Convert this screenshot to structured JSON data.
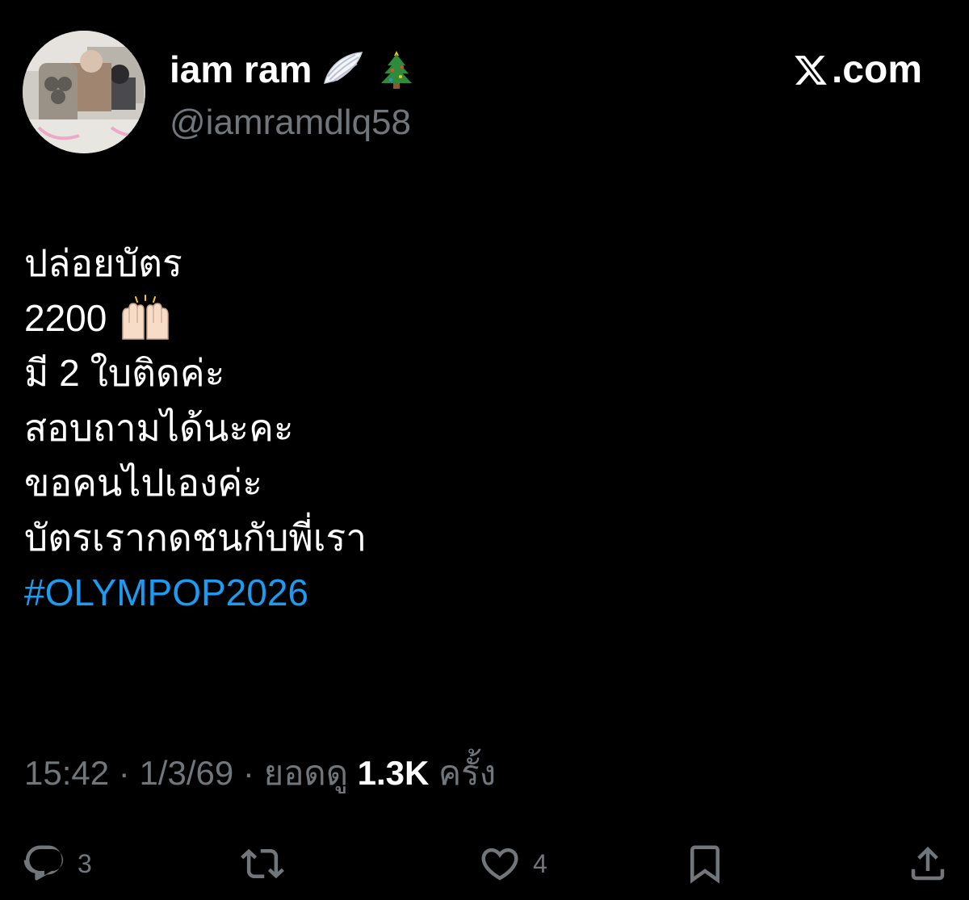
{
  "header": {
    "display_name": "iam ram",
    "name_emojis": [
      "wing-emoji",
      "christmas-tree-emoji"
    ],
    "handle": "@iamramdlq58",
    "brand": {
      "logo": "x-logo-icon",
      "domain": ".com"
    },
    "avatar": "profile-photo"
  },
  "tweet": {
    "lines": [
      "ปล่อยบัตร",
      "2200",
      "มี 2 ใบติดค่ะ",
      "สอบถามได้นะคะ",
      "ขอคนไปเองค่ะ",
      "บัตรเรากดชนกับพี่เรา"
    ],
    "line2_emoji": "raising-hands-emoji",
    "hashtag": "#OLYMPOP2026"
  },
  "meta": {
    "time": "15:42",
    "separator": "·",
    "date": "1/3/69",
    "views_label": "ยอดดู",
    "views_count": "1.3K",
    "views_suffix": "ครั้ง"
  },
  "actions": {
    "reply_count": "3",
    "repost_count": "",
    "like_count": "4",
    "bookmark_count": "",
    "share_count": ""
  },
  "colors": {
    "background": "#000000",
    "text_primary": "#ffffff",
    "text_secondary": "#71767b",
    "link": "#1d9bf0"
  }
}
